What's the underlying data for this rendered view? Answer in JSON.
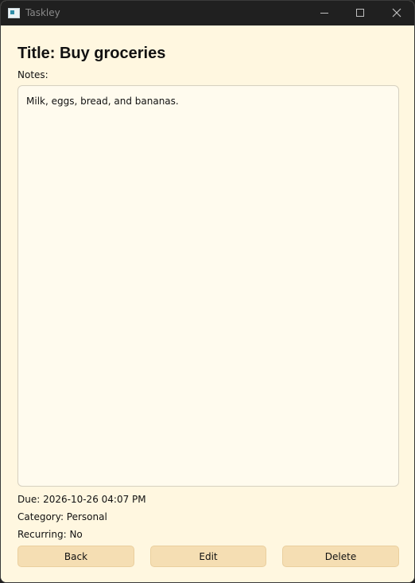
{
  "window": {
    "app_title": "Taskley"
  },
  "task": {
    "title": "Title: Buy groceries",
    "notes_label": "Notes:",
    "notes": "Milk, eggs, bread, and bananas.",
    "due": "Due: 2026-10-26 04:07 PM",
    "category": "Category: Personal",
    "recurring": "Recurring: No"
  },
  "buttons": {
    "back": "Back",
    "edit": "Edit",
    "delete": "Delete"
  },
  "colors": {
    "background": "#fff7e0",
    "button": "#f5deb3",
    "titlebar": "#202020"
  }
}
